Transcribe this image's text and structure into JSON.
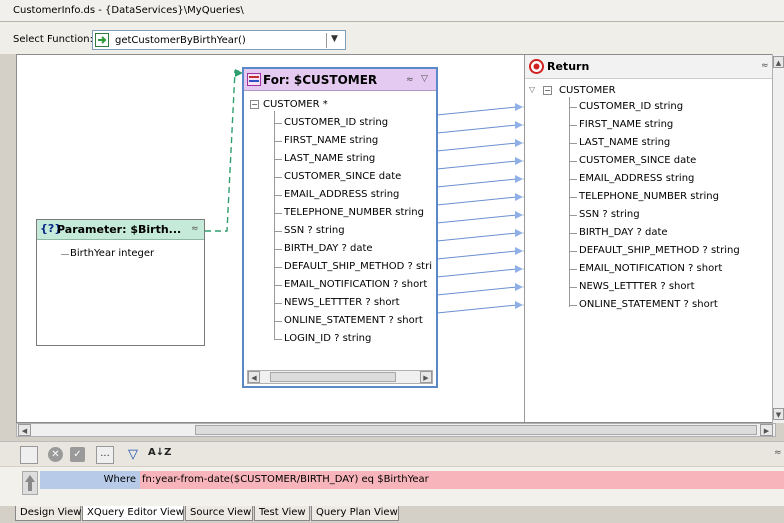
{
  "window": {
    "title": "CustomerInfo.ds - {DataServices}\\MyQueries\\"
  },
  "function_selector": {
    "label": "Select Function:",
    "value": "getCustomerByBirthYear()"
  },
  "parameter_box": {
    "title": "Parameter: $Birth...",
    "field": "BirthYear  integer"
  },
  "for_box": {
    "title": "For: $CUSTOMER",
    "root": "CUSTOMER *",
    "fields": [
      "CUSTOMER_ID  string",
      "FIRST_NAME  string",
      "LAST_NAME  string",
      "CUSTOMER_SINCE  date",
      "EMAIL_ADDRESS  string",
      "TELEPHONE_NUMBER  string",
      "SSN ?  string",
      "BIRTH_DAY ?  date",
      "DEFAULT_SHIP_METHOD ?  stri",
      "EMAIL_NOTIFICATION ?  short",
      "NEWS_LETTTER ?  short",
      "ONLINE_STATEMENT ?  short",
      "LOGIN_ID ?  string"
    ]
  },
  "return_panel": {
    "title": "Return",
    "root": "CUSTOMER",
    "fields": [
      "CUSTOMER_ID  string",
      "FIRST_NAME  string",
      "LAST_NAME  string",
      "CUSTOMER_SINCE  date",
      "EMAIL_ADDRESS  string",
      "TELEPHONE_NUMBER  string",
      "SSN ?  string",
      "BIRTH_DAY ?  date",
      "DEFAULT_SHIP_METHOD ?  string",
      "EMAIL_NOTIFICATION ?  short",
      "NEWS_LETTTER ?  short",
      "ONLINE_STATEMENT ?  short"
    ]
  },
  "toolbar": {
    "buttons": [
      "blank-button",
      "delete-icon",
      "check-icon",
      "ellipsis-button",
      "filter-icon",
      "sort-az-icon"
    ],
    "ellipsis": "...",
    "sort_glyph": "A↓Z"
  },
  "where_clause": {
    "label": "Where",
    "expression": "fn:year-from-date($CUSTOMER/BIRTH_DAY) eq  $BirthYear"
  },
  "tabs": [
    {
      "label": "Design View",
      "active": false
    },
    {
      "label": "XQuery Editor View",
      "active": true
    },
    {
      "label": "Source View",
      "active": false
    },
    {
      "label": "Test View",
      "active": false
    },
    {
      "label": "Query Plan View",
      "active": false
    }
  ],
  "colors": {
    "parameter_header": "#c5ead9",
    "for_header": "#e4c9f0",
    "where_label_bg": "#b7cbe8",
    "where_expr_bg": "#f7b5bb",
    "link_line": "#6a8fd0",
    "param_link": "#2e9e6e"
  }
}
